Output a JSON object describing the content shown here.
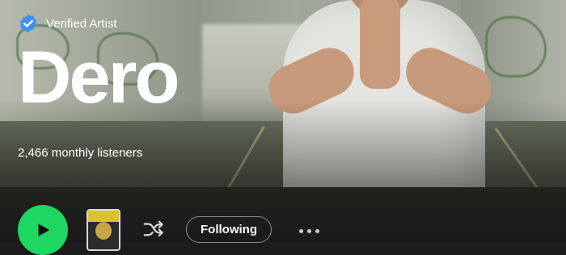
{
  "artist": {
    "verified_label": "Verified Artist",
    "name": "Dero",
    "monthly_listeners": "2,466 monthly listeners"
  },
  "controls": {
    "following_label": "Following",
    "icons": [
      "play-icon",
      "shuffle-icon",
      "more-options-icon"
    ]
  },
  "colors": {
    "accent": "#1ed760",
    "verified_badge": "#3d91f4",
    "background": "#1c1c1c"
  }
}
